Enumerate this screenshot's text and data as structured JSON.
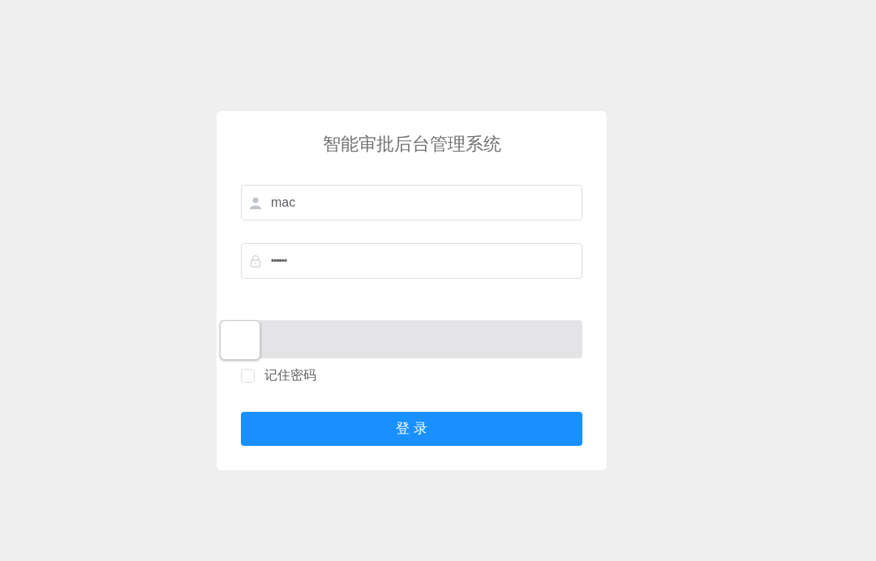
{
  "title": "智能审批后台管理系统",
  "username": {
    "value": "mac"
  },
  "password": {
    "value": "••••••"
  },
  "slider": {
    "level": 0
  },
  "remember": {
    "label": "记住密码",
    "checked": false
  },
  "login_button": "登 录"
}
